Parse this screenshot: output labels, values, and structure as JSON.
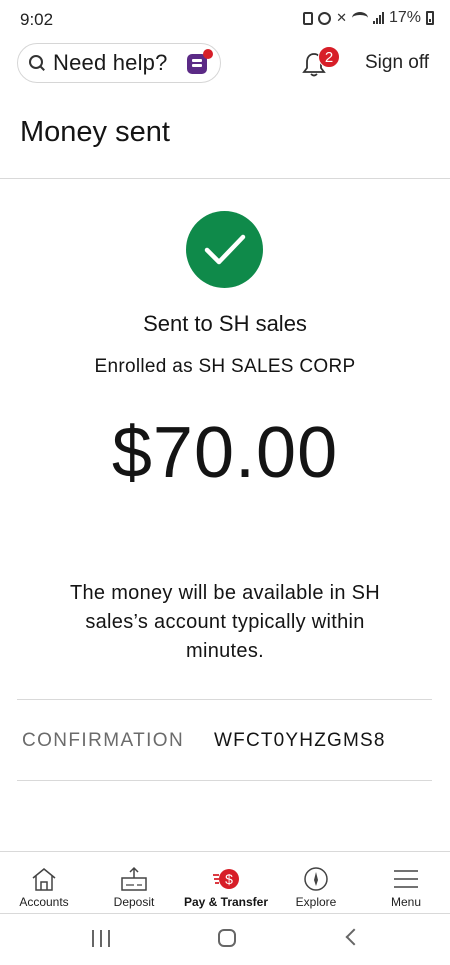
{
  "status_bar": {
    "time": "9:02",
    "battery": "17%"
  },
  "header": {
    "help_text": "Need help?",
    "notification_count": "2",
    "sign_off_label": "Sign off"
  },
  "page": {
    "title": "Money sent"
  },
  "confirmation": {
    "sent_to": "Sent to SH sales",
    "enrolled_as": "Enrolled as SH SALES CORP",
    "amount": "$70.00",
    "availability_note": "The money will be available in SH sales’s account typically within minutes.",
    "confirmation_label": "CONFIRMATION",
    "confirmation_number": "WFCT0YHZGMS8"
  },
  "bottom_nav": {
    "items": [
      {
        "label": "Accounts",
        "icon": "home-icon"
      },
      {
        "label": "Deposit",
        "icon": "deposit-icon"
      },
      {
        "label": "Pay & Transfer",
        "icon": "pay-transfer-icon",
        "active": true
      },
      {
        "label": "Explore",
        "icon": "compass-icon"
      },
      {
        "label": "Menu",
        "icon": "hamburger-menu-icon"
      }
    ]
  },
  "colors": {
    "success_green": "#0f8a4a",
    "brand_red": "#d71e28",
    "assistant_purple": "#5b2a86"
  }
}
